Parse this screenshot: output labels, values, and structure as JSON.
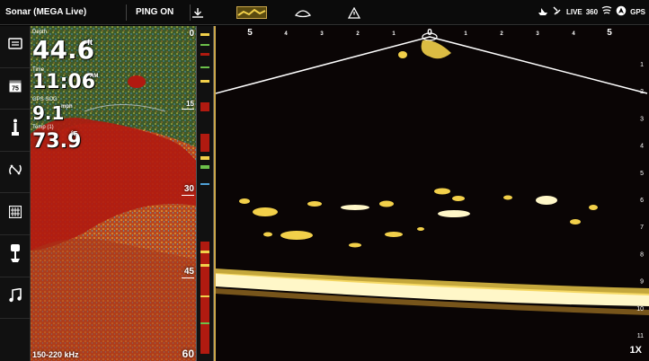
{
  "topbar": {
    "title": "Sonar (MEGA Live)",
    "ping": "PING ON",
    "status_live": "LIVE",
    "status_360": "360",
    "status_gps": "GPS"
  },
  "sidebar": {
    "items": [
      {
        "icon": "display-icon"
      },
      {
        "icon": "temp-gauge-icon",
        "label": "75"
      },
      {
        "icon": "transducer-icon"
      },
      {
        "icon": "sonar-sweep-icon"
      },
      {
        "icon": "grid-settings-icon"
      },
      {
        "icon": "trolling-motor-icon"
      },
      {
        "icon": "music-icon"
      }
    ]
  },
  "readouts": {
    "depth_label": "Depth",
    "depth_value": "44.6",
    "depth_unit": "ft",
    "time_label": "Time",
    "time_value": "11:06",
    "time_ampm": "AM",
    "sog_label": "GPS SOG",
    "sog_value": "9.1",
    "sog_unit": "mph",
    "temp_label": "Temp (1)",
    "temp_value": "73.9",
    "temp_unit": "°F"
  },
  "down_scale": [
    "0",
    "15",
    "30",
    "45",
    "60"
  ],
  "frequency": "150-220 kHz",
  "live": {
    "range_labels": [
      "5",
      "4",
      "3",
      "2",
      "1",
      "0",
      "1",
      "2",
      "3",
      "4",
      "5"
    ],
    "depth_labels": [
      "1",
      "2",
      "3",
      "4",
      "5",
      "6",
      "7",
      "8",
      "9",
      "10",
      "11"
    ],
    "zoom": "1X"
  },
  "colors": {
    "accent": "#caa64a",
    "sonar_red": "#b01a10",
    "sonar_yellow": "#f2d04a"
  }
}
